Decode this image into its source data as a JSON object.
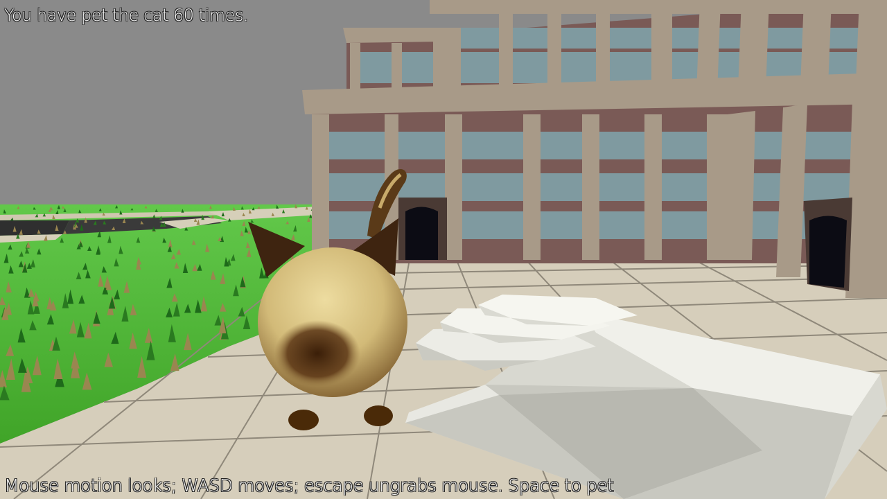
{
  "hud": {
    "pet_counter_text": "You have pet the cat 60 times.",
    "controls_hint_text": "Mouse motion looks; WASD moves; escape ungrabs mouse. Space to pet"
  },
  "colors": {
    "sky": "#8a8a8a",
    "grass": "#55c23a",
    "pavement": "#d8d0bc",
    "building_wall": "#7a5a56",
    "building_glass": "#7f9aa0",
    "building_frame": "#a89a88",
    "cat_body": "#d8c080",
    "cat_markings": "#4a2a10",
    "hand": "#e8e8e0",
    "hud_text": "#f2f2f2"
  },
  "icons": [
    "cat-character",
    "player-hand"
  ]
}
